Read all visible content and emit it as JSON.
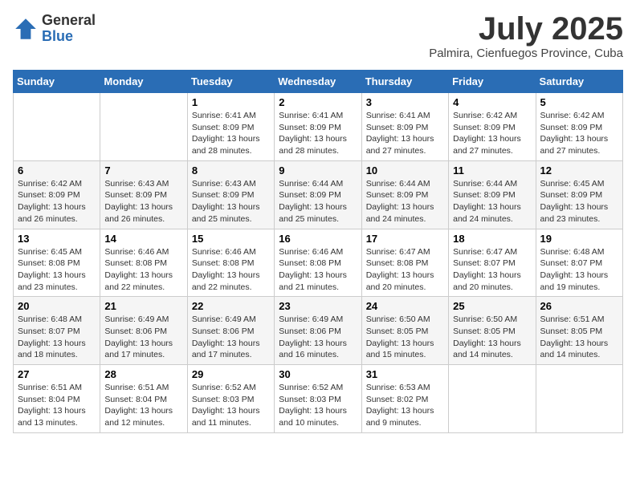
{
  "logo": {
    "general": "General",
    "blue": "Blue"
  },
  "title": "July 2025",
  "location": "Palmira, Cienfuegos Province, Cuba",
  "weekdays": [
    "Sunday",
    "Monday",
    "Tuesday",
    "Wednesday",
    "Thursday",
    "Friday",
    "Saturday"
  ],
  "weeks": [
    [
      {
        "day": "",
        "info": ""
      },
      {
        "day": "",
        "info": ""
      },
      {
        "day": "1",
        "info": "Sunrise: 6:41 AM\nSunset: 8:09 PM\nDaylight: 13 hours and 28 minutes."
      },
      {
        "day": "2",
        "info": "Sunrise: 6:41 AM\nSunset: 8:09 PM\nDaylight: 13 hours and 28 minutes."
      },
      {
        "day": "3",
        "info": "Sunrise: 6:41 AM\nSunset: 8:09 PM\nDaylight: 13 hours and 27 minutes."
      },
      {
        "day": "4",
        "info": "Sunrise: 6:42 AM\nSunset: 8:09 PM\nDaylight: 13 hours and 27 minutes."
      },
      {
        "day": "5",
        "info": "Sunrise: 6:42 AM\nSunset: 8:09 PM\nDaylight: 13 hours and 27 minutes."
      }
    ],
    [
      {
        "day": "6",
        "info": "Sunrise: 6:42 AM\nSunset: 8:09 PM\nDaylight: 13 hours and 26 minutes."
      },
      {
        "day": "7",
        "info": "Sunrise: 6:43 AM\nSunset: 8:09 PM\nDaylight: 13 hours and 26 minutes."
      },
      {
        "day": "8",
        "info": "Sunrise: 6:43 AM\nSunset: 8:09 PM\nDaylight: 13 hours and 25 minutes."
      },
      {
        "day": "9",
        "info": "Sunrise: 6:44 AM\nSunset: 8:09 PM\nDaylight: 13 hours and 25 minutes."
      },
      {
        "day": "10",
        "info": "Sunrise: 6:44 AM\nSunset: 8:09 PM\nDaylight: 13 hours and 24 minutes."
      },
      {
        "day": "11",
        "info": "Sunrise: 6:44 AM\nSunset: 8:09 PM\nDaylight: 13 hours and 24 minutes."
      },
      {
        "day": "12",
        "info": "Sunrise: 6:45 AM\nSunset: 8:09 PM\nDaylight: 13 hours and 23 minutes."
      }
    ],
    [
      {
        "day": "13",
        "info": "Sunrise: 6:45 AM\nSunset: 8:08 PM\nDaylight: 13 hours and 23 minutes."
      },
      {
        "day": "14",
        "info": "Sunrise: 6:46 AM\nSunset: 8:08 PM\nDaylight: 13 hours and 22 minutes."
      },
      {
        "day": "15",
        "info": "Sunrise: 6:46 AM\nSunset: 8:08 PM\nDaylight: 13 hours and 22 minutes."
      },
      {
        "day": "16",
        "info": "Sunrise: 6:46 AM\nSunset: 8:08 PM\nDaylight: 13 hours and 21 minutes."
      },
      {
        "day": "17",
        "info": "Sunrise: 6:47 AM\nSunset: 8:08 PM\nDaylight: 13 hours and 20 minutes."
      },
      {
        "day": "18",
        "info": "Sunrise: 6:47 AM\nSunset: 8:07 PM\nDaylight: 13 hours and 20 minutes."
      },
      {
        "day": "19",
        "info": "Sunrise: 6:48 AM\nSunset: 8:07 PM\nDaylight: 13 hours and 19 minutes."
      }
    ],
    [
      {
        "day": "20",
        "info": "Sunrise: 6:48 AM\nSunset: 8:07 PM\nDaylight: 13 hours and 18 minutes."
      },
      {
        "day": "21",
        "info": "Sunrise: 6:49 AM\nSunset: 8:06 PM\nDaylight: 13 hours and 17 minutes."
      },
      {
        "day": "22",
        "info": "Sunrise: 6:49 AM\nSunset: 8:06 PM\nDaylight: 13 hours and 17 minutes."
      },
      {
        "day": "23",
        "info": "Sunrise: 6:49 AM\nSunset: 8:06 PM\nDaylight: 13 hours and 16 minutes."
      },
      {
        "day": "24",
        "info": "Sunrise: 6:50 AM\nSunset: 8:05 PM\nDaylight: 13 hours and 15 minutes."
      },
      {
        "day": "25",
        "info": "Sunrise: 6:50 AM\nSunset: 8:05 PM\nDaylight: 13 hours and 14 minutes."
      },
      {
        "day": "26",
        "info": "Sunrise: 6:51 AM\nSunset: 8:05 PM\nDaylight: 13 hours and 14 minutes."
      }
    ],
    [
      {
        "day": "27",
        "info": "Sunrise: 6:51 AM\nSunset: 8:04 PM\nDaylight: 13 hours and 13 minutes."
      },
      {
        "day": "28",
        "info": "Sunrise: 6:51 AM\nSunset: 8:04 PM\nDaylight: 13 hours and 12 minutes."
      },
      {
        "day": "29",
        "info": "Sunrise: 6:52 AM\nSunset: 8:03 PM\nDaylight: 13 hours and 11 minutes."
      },
      {
        "day": "30",
        "info": "Sunrise: 6:52 AM\nSunset: 8:03 PM\nDaylight: 13 hours and 10 minutes."
      },
      {
        "day": "31",
        "info": "Sunrise: 6:53 AM\nSunset: 8:02 PM\nDaylight: 13 hours and 9 minutes."
      },
      {
        "day": "",
        "info": ""
      },
      {
        "day": "",
        "info": ""
      }
    ]
  ]
}
